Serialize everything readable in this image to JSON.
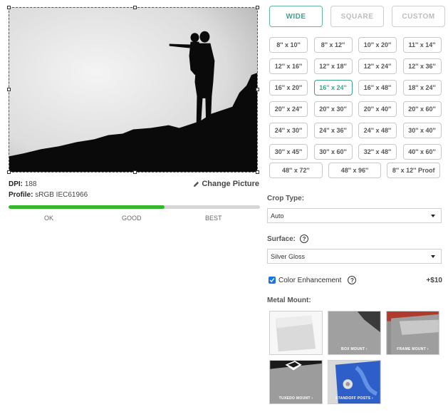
{
  "image_info": {
    "dpi_label": "DPI:",
    "dpi_value": "188",
    "profile_label": "Profile:",
    "profile_value": "sRGB IEC61966",
    "change_picture": "Change Picture"
  },
  "quality": {
    "level": 0.62,
    "labels": [
      "OK",
      "GOOD",
      "BEST"
    ],
    "fill_color": "#35b62c"
  },
  "orientation_tabs": [
    {
      "label": "WIDE",
      "active": true
    },
    {
      "label": "SQUARE",
      "active": false
    },
    {
      "label": "CUSTOM",
      "active": false
    }
  ],
  "sizes": [
    "8'' x 10''",
    "8'' x 12''",
    "10'' x 20''",
    "11'' x 14''",
    "12'' x 16''",
    "12'' x 18''",
    "12'' x 24''",
    "12'' x 36''",
    "16'' x 20''",
    "16'' x 24''",
    "16'' x 48''",
    "18'' x 24''",
    "20'' x 24''",
    "20'' x 30''",
    "20'' x 40''",
    "20'' x 60''",
    "24'' x 30''",
    "24'' x 36''",
    "24'' x 48''",
    "30'' x 40''",
    "30'' x 45''",
    "30'' x 60''",
    "32'' x 48''",
    "40'' x 60''"
  ],
  "sizes_last_row": [
    "48'' x 72''",
    "48'' x 96''",
    "8'' x 12'' Proof"
  ],
  "selected_size": "16'' x 24''",
  "crop_type": {
    "label": "Crop Type:",
    "value": "Auto"
  },
  "surface": {
    "label": "Surface:",
    "value": "Silver Gloss"
  },
  "color_enhancement": {
    "label": "Color Enhancement",
    "checked": true,
    "price": "+$10"
  },
  "metal_mount": {
    "label": "Metal Mount:",
    "options": [
      {
        "caption": ""
      },
      {
        "caption": "BOX MOUNT ›"
      },
      {
        "caption": "FRAME MOUNT ›"
      },
      {
        "caption": "TUXEDO MOUNT ›"
      },
      {
        "caption": "STANDOFF POSTS ›"
      }
    ]
  },
  "colors": {
    "accent": "#3aa48a",
    "checkbox": "#1a73e8"
  }
}
